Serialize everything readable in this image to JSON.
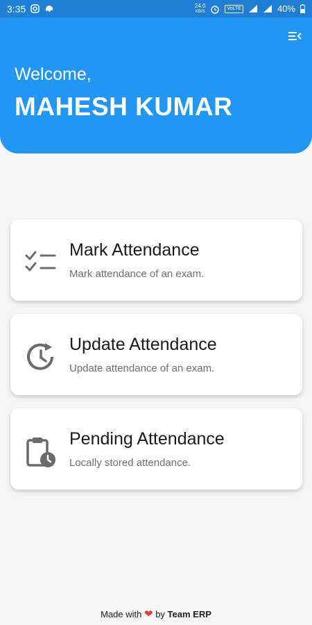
{
  "status_bar": {
    "time": "3:35",
    "speed_value": "24.0",
    "speed_unit": "KB/S",
    "volte": "VoLTE",
    "battery": "40%"
  },
  "header": {
    "welcome": "Welcome,",
    "username": "MAHESH KUMAR",
    "menu_icon": "menu-collapse-icon",
    "color": "#2196f3"
  },
  "cards": [
    {
      "title": "Mark Attendance",
      "subtitle": "Mark attendance of an exam.",
      "icon": "checklist-icon"
    },
    {
      "title": "Update Attendance",
      "subtitle": "Update attendance of an exam.",
      "icon": "history-icon"
    },
    {
      "title": "Pending Attendance",
      "subtitle": "Locally stored attendance.",
      "icon": "clipboard-clock-icon"
    }
  ],
  "footer": {
    "made_with": "Made with",
    "by": "by",
    "team": "Team ERP"
  }
}
